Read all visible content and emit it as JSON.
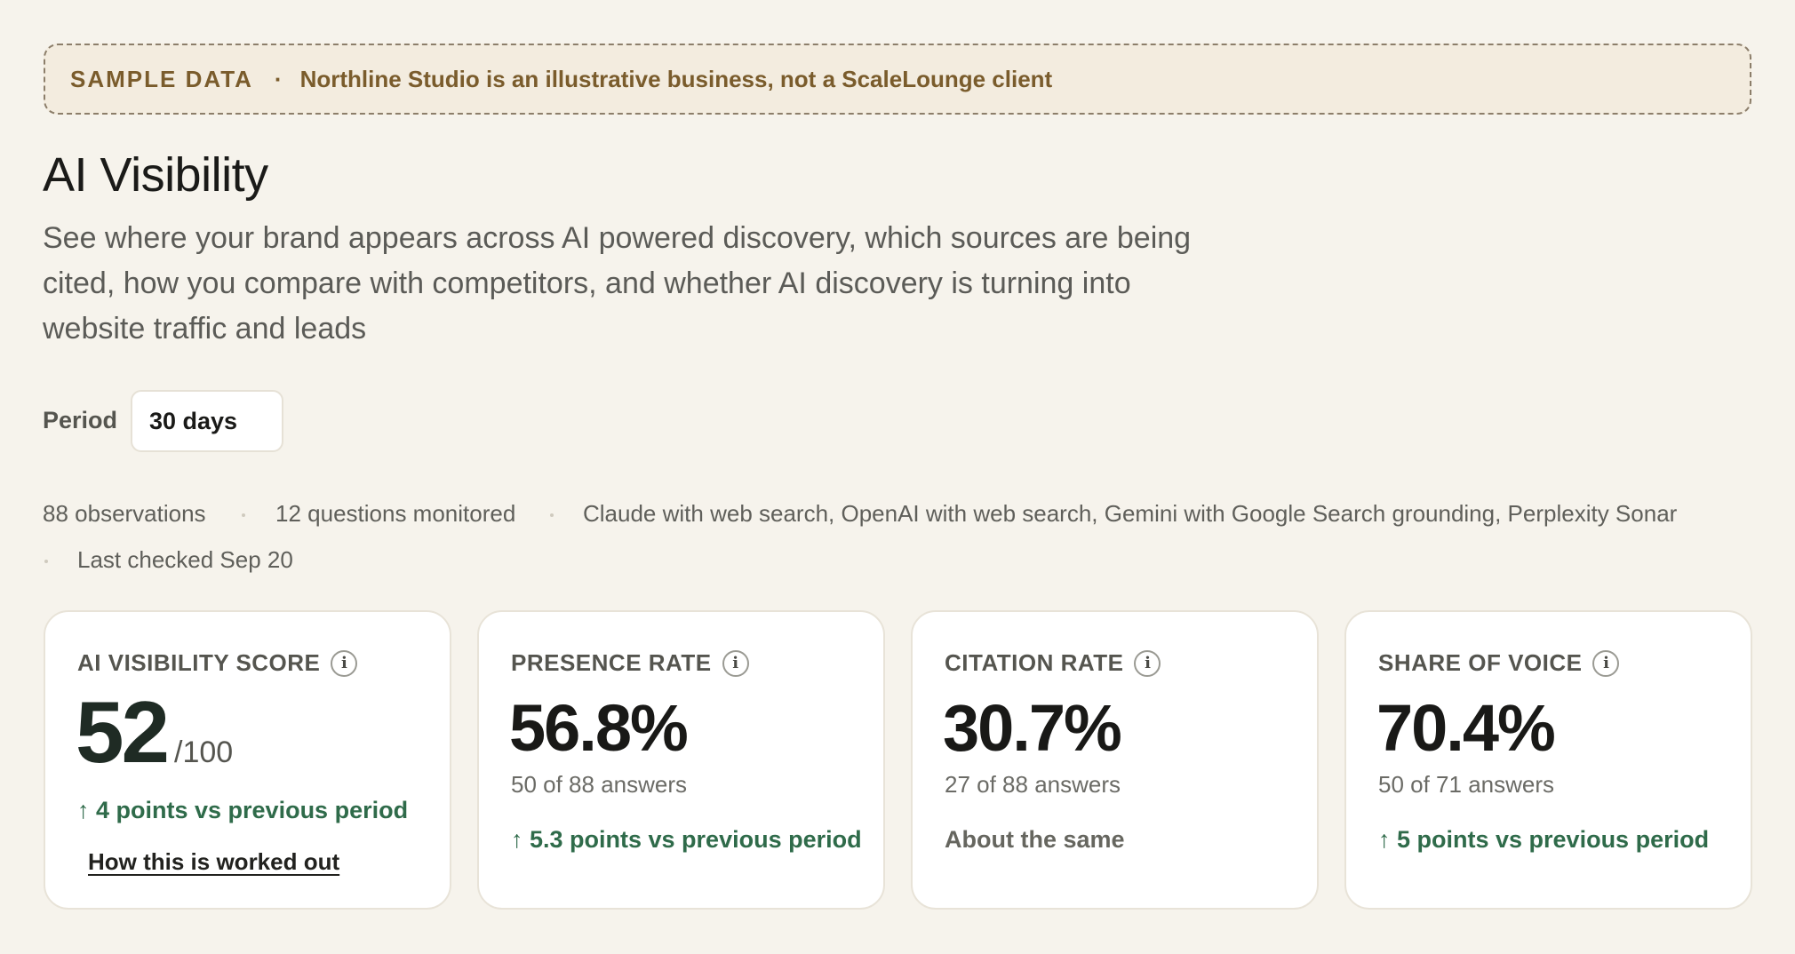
{
  "banner": {
    "tag": "SAMPLE DATA",
    "separator": "·",
    "message": "Northline Studio is an illustrative business, not a ScaleLounge client"
  },
  "page": {
    "title": "AI Visibility",
    "subtitle": "See where your brand appears across AI powered discovery, which sources are being cited, how you compare with competitors, and whether AI discovery is turning into website traffic and leads"
  },
  "filters": {
    "period_label": "Period",
    "period_value": "30 days"
  },
  "meta": {
    "observations": "88 observations",
    "questions": "12 questions monitored",
    "engines": "Claude with web search, OpenAI with web search, Gemini with Google Search grounding, Perplexity Sonar",
    "last_checked": "Last checked Sep 20"
  },
  "cards": {
    "score": {
      "label": "AI VISIBILITY SCORE",
      "info_icon": "i",
      "value": "52",
      "max": "/100",
      "delta": "↑ 4 points vs previous period",
      "link": "How this is worked out"
    },
    "presence": {
      "label": "PRESENCE RATE",
      "info_icon": "i",
      "value": "56.8%",
      "detail": "50 of 88 answers",
      "delta": "↑ 5.3 points vs previous period"
    },
    "citation": {
      "label": "CITATION RATE",
      "info_icon": "i",
      "value": "30.7%",
      "detail": "27 of 88 answers",
      "delta": "About the same"
    },
    "share": {
      "label": "SHARE OF VOICE",
      "info_icon": "i",
      "value": "70.4%",
      "detail": "50 of 71 answers",
      "delta": "↑ 5 points vs previous period"
    }
  },
  "colors": {
    "background": "#f6f3ec",
    "banner_text": "#7a5c2c",
    "positive": "#2f6b4a",
    "score": "#1f2b24"
  }
}
